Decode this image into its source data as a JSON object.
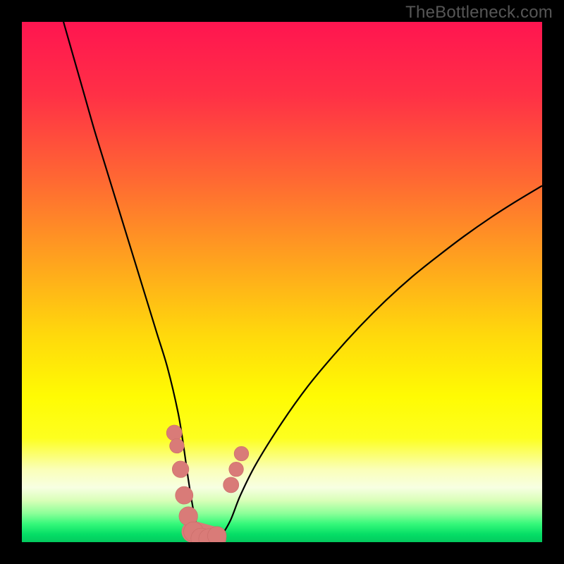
{
  "watermark": "TheBottleneck.com",
  "colors": {
    "black": "#000000",
    "curve": "#000000",
    "marker_fill": "#d97b78",
    "marker_stroke": "#c96c69",
    "gradient_stops": [
      {
        "offset": 0.0,
        "c": "#ff1550"
      },
      {
        "offset": 0.14,
        "c": "#ff3046"
      },
      {
        "offset": 0.3,
        "c": "#ff6733"
      },
      {
        "offset": 0.46,
        "c": "#ffa31e"
      },
      {
        "offset": 0.6,
        "c": "#ffd80c"
      },
      {
        "offset": 0.72,
        "c": "#fffb03"
      },
      {
        "offset": 0.8,
        "c": "#fdff1f"
      },
      {
        "offset": 0.86,
        "c": "#faffb8"
      },
      {
        "offset": 0.895,
        "c": "#f7ffe2"
      },
      {
        "offset": 0.92,
        "c": "#d9ffb8"
      },
      {
        "offset": 0.945,
        "c": "#8bff98"
      },
      {
        "offset": 0.965,
        "c": "#35f87a"
      },
      {
        "offset": 0.985,
        "c": "#05de66"
      },
      {
        "offset": 1.0,
        "c": "#03c95e"
      }
    ]
  },
  "chart_data": {
    "type": "line",
    "title": "",
    "xlabel": "",
    "ylabel": "",
    "xlim": [
      0,
      100
    ],
    "ylim": [
      0,
      100
    ],
    "grid": false,
    "legend": false,
    "series": [
      {
        "name": "bottleneck-curve",
        "x": [
          8,
          10,
          12,
          14,
          16,
          18,
          20,
          22,
          24,
          26,
          28,
          30,
          31,
          32,
          33,
          34,
          35,
          36,
          38,
          40,
          42,
          45,
          50,
          55,
          60,
          65,
          70,
          75,
          80,
          85,
          90,
          95,
          100
        ],
        "y": [
          100,
          93,
          86,
          79,
          72.5,
          66,
          59.5,
          53,
          46.5,
          40,
          33.5,
          25,
          19,
          12,
          6,
          2,
          0.5,
          0.5,
          1,
          4,
          9,
          15,
          23,
          30,
          36,
          41.5,
          46.5,
          51,
          55,
          58.8,
          62.3,
          65.5,
          68.5
        ]
      }
    ],
    "markers": {
      "name": "highlight-points",
      "points": [
        {
          "x": 29.3,
          "y": 21,
          "r": 1.5
        },
        {
          "x": 29.8,
          "y": 18.5,
          "r": 1.4
        },
        {
          "x": 30.5,
          "y": 14,
          "r": 1.6
        },
        {
          "x": 31.2,
          "y": 9,
          "r": 1.7
        },
        {
          "x": 32.0,
          "y": 5,
          "r": 1.8
        },
        {
          "x": 33.0,
          "y": 2,
          "r": 1.9
        },
        {
          "x": 34.5,
          "y": 0.7,
          "r": 2.0
        },
        {
          "x": 36.0,
          "y": 0.6,
          "r": 2.0
        },
        {
          "x": 37.5,
          "y": 1.2,
          "r": 1.8
        },
        {
          "x": 40.2,
          "y": 11,
          "r": 1.5
        },
        {
          "x": 41.2,
          "y": 14,
          "r": 1.4
        },
        {
          "x": 42.2,
          "y": 17,
          "r": 1.4
        }
      ],
      "bar": {
        "x1": 32.8,
        "y1": 2.0,
        "x2": 37.2,
        "y2": 0.8,
        "r": 2.1
      }
    }
  }
}
